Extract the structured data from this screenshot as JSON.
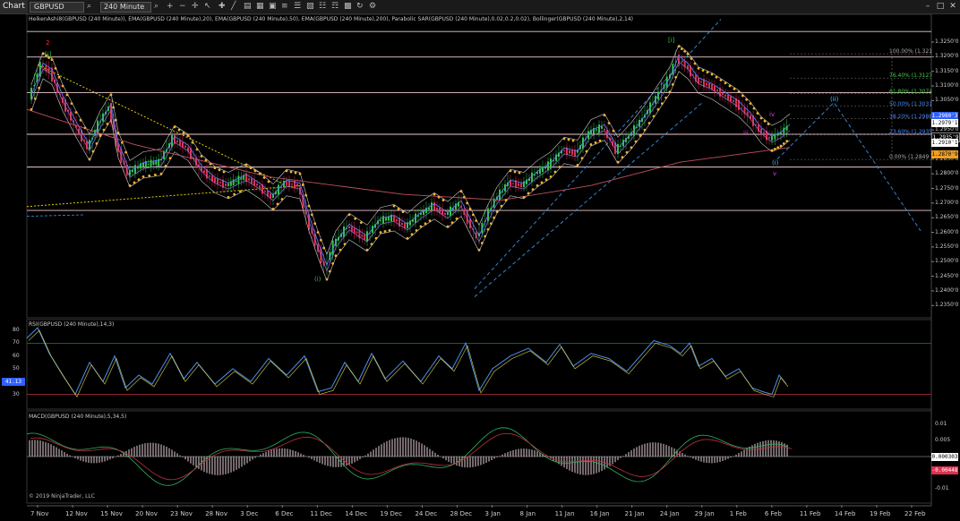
{
  "toolbar": {
    "chart_tab": "Chart",
    "symbol": "GBPUSD",
    "interval": "240 Minute",
    "icons": [
      "search-icon",
      "magnifier-icon",
      "zoom-in-icon",
      "zoom-out-icon",
      "crosshair-icon",
      "pointer-icon",
      "draw-icon",
      "line-icon",
      "text-icon",
      "grid-icon",
      "copy-icon",
      "bar-style-icon",
      "properties-icon",
      "template-icon",
      "indicator-icon",
      "strategy-icon",
      "calendar-icon",
      "refresh-icon",
      "gear-icon"
    ]
  },
  "price_panel": {
    "title": "HeikenAshi8(GBPUSD (240 Minute)), EMA(GBPUSD (240 Minute),20), EMA(GBPUSD (240 Minute),50), EMA(GBPUSD (240 Minute),200), Parabolic SAR(GBPUSD (240 Minute),0.02,0.2,0.02), Bollinger(GBPUSD (240 Minute),2,14)",
    "scale": [
      "1.3250'0",
      "1.3200'0",
      "1.3150'0",
      "1.3100'0",
      "1.3050'0",
      "1.3000'0",
      "1.2950'0",
      "1.2900'0",
      "1.2850'0",
      "1.2800'0",
      "1.2750'0",
      "1.2700'0",
      "1.2650'0",
      "1.2600'0",
      "1.2550'0",
      "1.2500'0",
      "1.2450'0",
      "1.2400'0",
      "1.2350'0"
    ],
    "price_tags": [
      {
        "text": "1.2980'3",
        "color": "#3060ff",
        "fg": "#fff"
      },
      {
        "text": "1.2979'1",
        "color": "#ffffff",
        "fg": "#000"
      },
      {
        "text": "1.2935'9",
        "color": "#000000",
        "fg": "#fff"
      },
      {
        "text": "1.2910'1",
        "color": "#ffffff",
        "fg": "#000"
      },
      {
        "text": "1.2870'9",
        "color": "#f0a020",
        "fg": "#000"
      }
    ],
    "fib_labels": [
      {
        "text": "100.00% (1.321",
        "color": "#aaaaaa"
      },
      {
        "text": "76.40% (1.3127",
        "color": "#44cc44"
      },
      {
        "text": "61.80% (1.3074",
        "color": "#44cc44"
      },
      {
        "text": "50.00% (1.3031",
        "color": "#4488ff"
      },
      {
        "text": "38.20% (1.2988",
        "color": "#4488ff"
      },
      {
        "text": "23.60% (1.2935",
        "color": "#4488ff"
      },
      {
        "text": "0.00% (1.2849",
        "color": "#aaaaaa"
      }
    ],
    "wave_labels": [
      {
        "text": "2",
        "color": "#ff3030"
      },
      {
        "text": "[i]",
        "color": "#30c030"
      },
      {
        "text": "[i]",
        "color": "#30c030"
      },
      {
        "text": "(i)",
        "color": "#30c030"
      },
      {
        "text": "iv",
        "color": "#d040d0"
      },
      {
        "text": "iii",
        "color": "#d040d0"
      },
      {
        "text": "(i)",
        "color": "#40c0ff"
      },
      {
        "text": "v",
        "color": "#d040d0"
      },
      {
        "text": "(ii)",
        "color": "#40c0ff"
      }
    ]
  },
  "rsi_panel": {
    "title": "RSI(GBPUSD (240 Minute),14,3)",
    "scale": [
      "80",
      "70",
      "60",
      "50",
      "40",
      "30"
    ],
    "value_tag": "41.13"
  },
  "macd_panel": {
    "title": "MACD(GBPUSD (240 Minute),5,34,5)",
    "scale": [
      "0.01",
      "0.005",
      "0",
      "-0.005",
      "-0.01"
    ],
    "tags": [
      {
        "text": "0.000303",
        "color": "#ffffff",
        "fg": "#000"
      },
      {
        "text": "-0.00448",
        "color": "#e03050",
        "fg": "#fff"
      }
    ],
    "copyright": "© 2019 NinjaTrader, LLC"
  },
  "x_axis": [
    "7 Nov",
    "12 Nov",
    "15 Nov",
    "20 Nov",
    "23 Nov",
    "28 Nov",
    "3 Dec",
    "6 Dec",
    "11 Dec",
    "14 Dec",
    "19 Dec",
    "24 Dec",
    "28 Dec",
    "3 Jan",
    "8 Jan",
    "11 Jan",
    "16 Jan",
    "21 Jan",
    "24 Jan",
    "29 Jan",
    "1 Feb",
    "6 Feb",
    "11 Feb",
    "14 Feb",
    "19 Feb",
    "22 Feb"
  ],
  "colors": {
    "bull": "#2ec84a",
    "bear": "#e03050",
    "sar": "#f5b030",
    "ema": "#6080ff",
    "ema200": "#c05060",
    "bollinger": "#cccccc",
    "hline": "#f0c8d0",
    "fib_line": "#777777",
    "trend_blue": "#3a8fe0",
    "trend_yellow": "#e6d000"
  }
}
